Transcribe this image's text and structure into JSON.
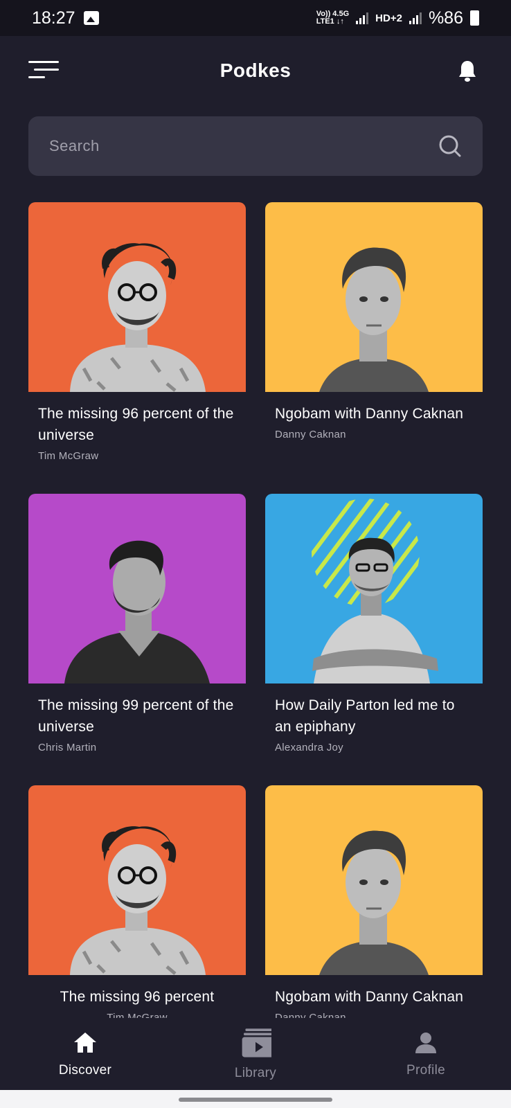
{
  "status_bar": {
    "time": "18:27",
    "net_top": "Vo)) 4.5G",
    "net_bottom": "LTE1 ↓↑",
    "hd": "HD+2",
    "battery": "%86",
    "icons": [
      "gallery-icon",
      "signal-icon",
      "battery-icon"
    ]
  },
  "header": {
    "title": "Podkes",
    "menu_icon": "menu-icon",
    "bell_icon": "bell-icon"
  },
  "search": {
    "placeholder": "Search",
    "value": "",
    "icon": "search-icon"
  },
  "cards": [
    {
      "title": "The missing 96 percent of the universe",
      "author": "Tim McGraw",
      "bg": "#ec663a",
      "portrait": "curly-hair-man"
    },
    {
      "title": "Ngobam with Danny Caknan",
      "author": "Danny Caknan",
      "bg": "#fdbd48",
      "portrait": "short-hair-man"
    },
    {
      "title": "The missing 99 percent of the universe",
      "author": "Chris Martin",
      "bg": "#b64ac9",
      "portrait": "bearded-man"
    },
    {
      "title": "How Daily Parton led me to an epiphany",
      "author": "Alexandra Joy",
      "bg": "#38a7e3",
      "portrait": "crossed-arms-man"
    },
    {
      "title": "The missing 96 percent",
      "author": "Tim McGraw",
      "bg": "#ec663a",
      "portrait": "curly-hair-man"
    },
    {
      "title": "Ngobam with Danny Caknan",
      "author": "Danny Caknan",
      "bg": "#fdbd48",
      "portrait": "short-hair-man"
    }
  ],
  "bottom_nav": {
    "items": [
      {
        "label": "Discover",
        "icon": "home-icon",
        "active": true
      },
      {
        "label": "Library",
        "icon": "library-icon",
        "active": false
      },
      {
        "label": "Profile",
        "icon": "profile-icon",
        "active": false
      }
    ]
  },
  "colors": {
    "background": "#1f1e2c",
    "status_bar": "#15141d",
    "search_bg": "#363545",
    "accent_lime": "#c8e84a"
  }
}
